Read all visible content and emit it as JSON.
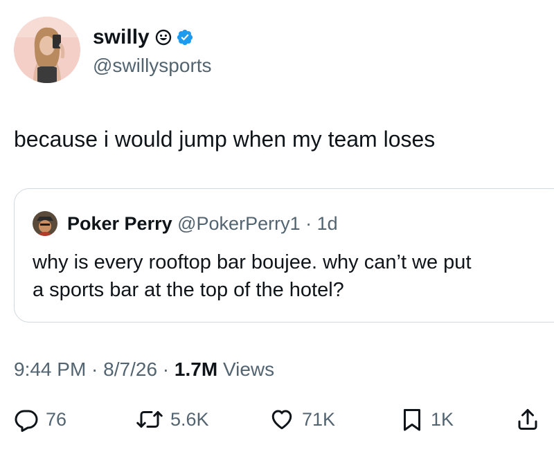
{
  "author": {
    "display_name": "swilly",
    "handle": "@swillysports",
    "avatar_icon": "profile-photo",
    "badges": [
      "smiley-emoji-icon",
      "verified-badge-icon"
    ],
    "verified_color": "#1d9bf0"
  },
  "tweet": {
    "text": "because i would jump when my team loses"
  },
  "quoted_tweet": {
    "display_name": "Poker Perry",
    "handle": "@PokerPerry1",
    "separator": " · ",
    "age": "1d",
    "text": "why is every rooftop bar boujee. why can’t we put\na sports bar at the top of the hotel?"
  },
  "meta": {
    "time": "9:44 PM",
    "separator": " · ",
    "date": "8/7/26",
    "views_count": "1.7M",
    "views_label": "Views"
  },
  "actions": {
    "replies": "76",
    "reposts": "5.6K",
    "likes": "71K",
    "bookmarks": "1K"
  },
  "colors": {
    "text_primary": "#0f1419",
    "text_secondary": "#536471",
    "border": "#cfd9de",
    "accent": "#1d9bf0"
  }
}
